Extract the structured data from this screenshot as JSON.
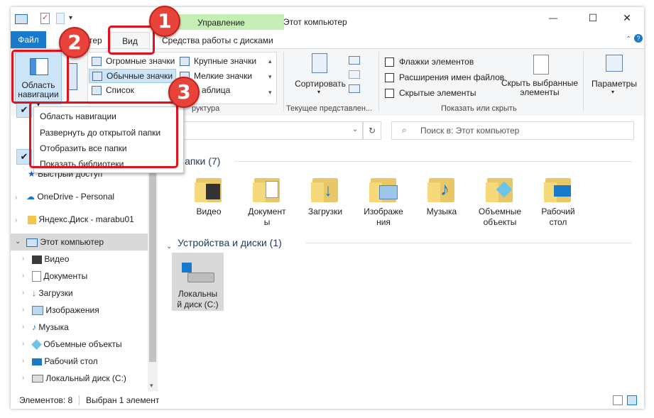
{
  "window": {
    "title": "Этот компьютер",
    "context_group": "Управление",
    "controls": {
      "minimize": "—",
      "maximize": "☐",
      "close": "✕"
    }
  },
  "tabs": {
    "file": "Файл",
    "computer_partial": "тер",
    "view": "Вид",
    "disk_tools": "Средства работы с дисками"
  },
  "ribbon": {
    "nav_pane_label_1": "Область",
    "nav_pane_label_2": "навигации",
    "layout": {
      "huge_icons": "Огромные значки",
      "large_icons": "Крупные значки",
      "normal_icons": "Обычные значки",
      "small_icons": "Мелкие значки",
      "list": "Список",
      "table_partial": "аблица",
      "group_label_partial": "руктура"
    },
    "current_view": {
      "sort_label": "Сортировать",
      "group_label": "Текущее представлен..."
    },
    "show_hide": {
      "item_checkboxes": "Флажки элементов",
      "file_extensions": "Расширения имен файлов",
      "hidden_items": "Скрытые элементы",
      "hide_selected_1": "Скрыть выбранные",
      "hide_selected_2": "элементы",
      "group_label": "Показать или скрыть"
    },
    "options": "Параметры"
  },
  "nav_dropdown": {
    "items": [
      {
        "label": "Область навигации",
        "checked": true
      },
      {
        "label": "Развернуть до открытой папки",
        "checked": false
      },
      {
        "label": "Отобразить все папки",
        "checked": false
      },
      {
        "label": "Показать библиотеки",
        "checked": true
      }
    ]
  },
  "address": {
    "path_partial": "р",
    "search_placeholder": "Поиск в: Этот компьютер"
  },
  "nav_pane": {
    "items": [
      {
        "label": "Быстрый доступ",
        "icon": "star-icon"
      },
      {
        "label": "OneDrive - Personal",
        "icon": "cloud-icon"
      },
      {
        "label": "Яндекс.Диск - marabu01",
        "icon": "yandex-disk-icon"
      },
      {
        "label": "Этот компьютер",
        "icon": "computer-icon"
      },
      {
        "label": "Видео",
        "icon": "video-icon"
      },
      {
        "label": "Документы",
        "icon": "documents-icon"
      },
      {
        "label": "Загрузки",
        "icon": "download-icon"
      },
      {
        "label": "Изображения",
        "icon": "pictures-icon"
      },
      {
        "label": "Музыка",
        "icon": "music-icon"
      },
      {
        "label": "Объемные объекты",
        "icon": "3d-objects-icon"
      },
      {
        "label": "Рабочий стол",
        "icon": "desktop-icon"
      },
      {
        "label": "Локальный диск (C:)",
        "icon": "drive-icon"
      }
    ]
  },
  "content": {
    "folders_header": "Папки (7)",
    "folders": [
      {
        "line1": "Видео",
        "line2": ""
      },
      {
        "line1": "Документ",
        "line2": "ы"
      },
      {
        "line1": "Загрузки",
        "line2": ""
      },
      {
        "line1": "Изображе",
        "line2": "ния"
      },
      {
        "line1": "Музыка",
        "line2": ""
      },
      {
        "line1": "Объемные",
        "line2": "объекты"
      },
      {
        "line1": "Рабочий",
        "line2": "стол"
      }
    ],
    "devices_header": "Устройства и диски (1)",
    "drive": {
      "line1": "Локальны",
      "line2": "й диск (C:)"
    }
  },
  "status": {
    "items_count": "Элементов: 8",
    "selected": "Выбран 1 элемент"
  },
  "annotations": {
    "badge_1": "1",
    "badge_2": "2",
    "badge_3": "3"
  },
  "colors": {
    "accent": "#1979ca",
    "annotation_red": "#e0121b",
    "context_band": "#c6efb5",
    "folder": "#e7c768"
  }
}
